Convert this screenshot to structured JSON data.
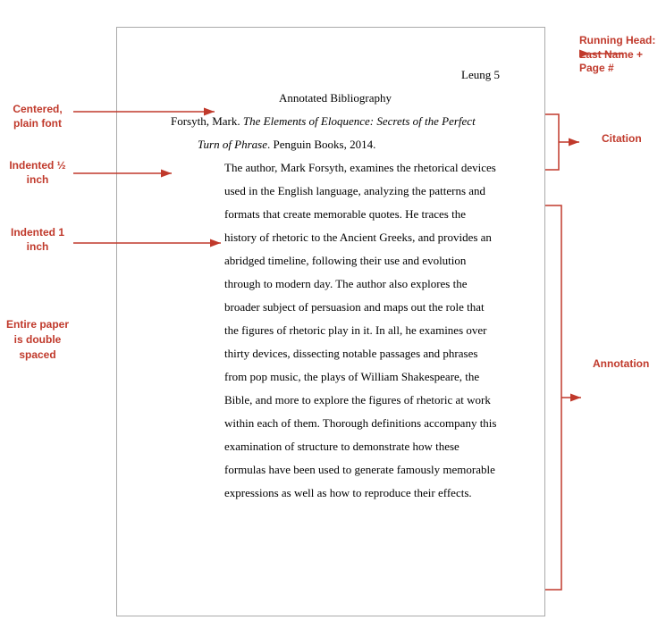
{
  "labels": {
    "centered": "Centered, plain font",
    "indented_half": "Indented ½ inch",
    "indented_one": "Indented 1 inch",
    "double_spaced": "Entire paper is double spaced",
    "running_head": "Running Head: Last Name + Page #",
    "citation": "Citation",
    "annotation": "Annotation"
  },
  "paper": {
    "running_head": "Leung 5",
    "title": "Annotated Bibliography",
    "citation_line1": "Forsyth, Mark. ",
    "citation_italic": "The Elements of Eloquence: Secrets of the Perfect Turn of Phrase",
    "citation_line2": ". Penguin Books, 2014.",
    "annotation": "The author, Mark Forsyth, examines the rhetorical devices used in the English language, analyzing the patterns and formats that create memorable quotes. He traces the history of rhetoric to the Ancient Greeks, and provides an abridged timeline, following their use and evolution through to modern day. The author also explores the broader subject of persuasion and maps out the role that the figures of rhetoric play in it. In all, he examines over thirty devices, dissecting notable passages and phrases from pop music, the plays of William Shakespeare, the Bible, and more to explore the figures of rhetoric at work within each of them. Thorough definitions accompany this examination of structure to demonstrate how these formulas have been used to generate famously memorable expressions as well as how to reproduce their effects."
  }
}
